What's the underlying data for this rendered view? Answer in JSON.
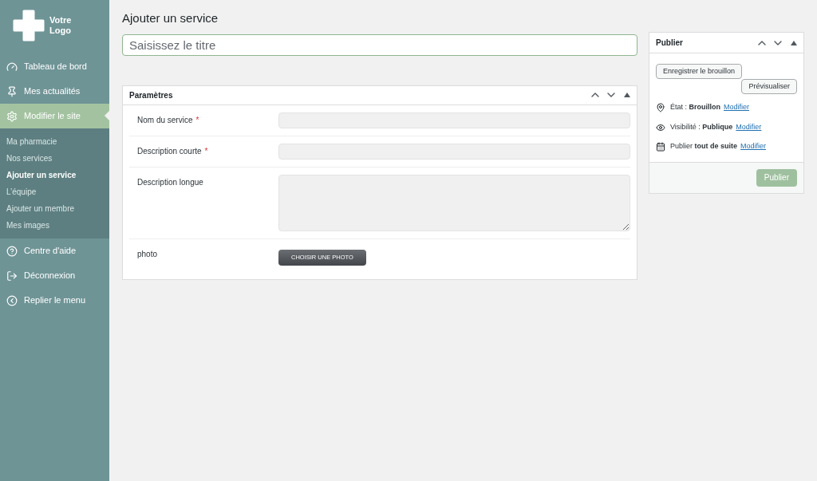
{
  "logo": {
    "text": "Votre Logo"
  },
  "sidebar": {
    "items": [
      {
        "label": "Tableau de bord",
        "kind": "top",
        "selected": false
      },
      {
        "label": "Mes actualités",
        "kind": "top",
        "selected": false
      },
      {
        "label": "Modifier le site",
        "kind": "top",
        "selected": true
      },
      {
        "label": "Ma pharmacie",
        "kind": "sub",
        "selected": false
      },
      {
        "label": "Nos services",
        "kind": "sub",
        "selected": false
      },
      {
        "label": "Ajouter un service",
        "kind": "sub",
        "selected": true
      },
      {
        "label": "L’équipe",
        "kind": "sub",
        "selected": false
      },
      {
        "label": "Ajouter un membre",
        "kind": "sub",
        "selected": false
      },
      {
        "label": "Mes images",
        "kind": "sub",
        "selected": false
      },
      {
        "label": "Centre d'aide",
        "kind": "top",
        "selected": false
      },
      {
        "label": "Déconnexion",
        "kind": "top",
        "selected": false
      },
      {
        "label": "Replier le menu",
        "kind": "top",
        "selected": false
      }
    ]
  },
  "page_title": "Ajouter un service",
  "title_field": {
    "placeholder": "Saisissez le titre"
  },
  "parameters": {
    "title": "Paramètres",
    "fields": [
      {
        "label": "Nom du service",
        "required_mark": "*",
        "kind": "text"
      },
      {
        "label": "Description courte",
        "required_mark": "*",
        "kind": "text"
      },
      {
        "label": "Description longue",
        "kind": "textarea"
      },
      {
        "label": "photo",
        "kind": "button",
        "button": "CHOISIR UNE PHOTO"
      }
    ]
  },
  "publish": {
    "title": "Publier",
    "save_draft": "Enregistrer le brouillon",
    "preview": "Prévisualiser",
    "lines": [
      {
        "text": "État : **Brouillon**",
        "link": "Modifier"
      },
      {
        "text": "Visibilité : **Publique**",
        "link": "Modifier"
      },
      {
        "text": "Publier **tout de suite**",
        "link": "Modifier"
      }
    ],
    "button": "Publier",
    "button_disabled": true
  }
}
